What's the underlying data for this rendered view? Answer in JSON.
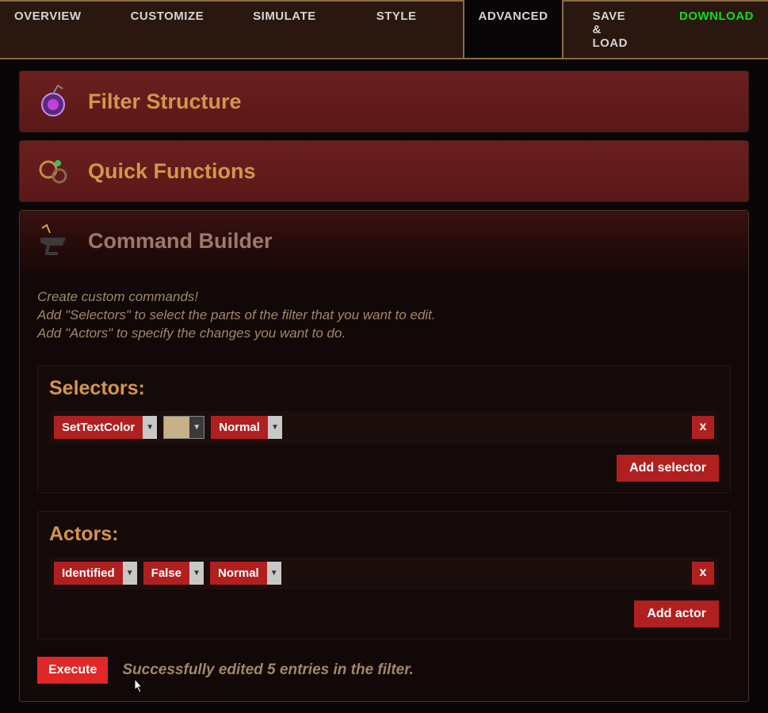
{
  "tabs": {
    "overview": "OVERVIEW",
    "customize": "CUSTOMIZE",
    "simulate": "SIMULATE",
    "style": "STYLE",
    "advanced": "ADVANCED",
    "saveload": "SAVE & LOAD",
    "download": "DOWNLOAD"
  },
  "panels": {
    "filter_structure": "Filter Structure",
    "quick_functions": "Quick Functions",
    "command_builder": "Command Builder"
  },
  "intro": {
    "line1": "Create custom commands!",
    "line2": "Add \"Selectors\" to select the parts of the filter that you want to edit.",
    "line3": "Add \"Actors\" to specify the changes you want to do."
  },
  "selectors": {
    "title": "Selectors:",
    "item1": "SetTextColor",
    "color": "#c8b088",
    "item2": "Normal",
    "close": "x",
    "add": "Add selector"
  },
  "actors": {
    "title": "Actors:",
    "item1": "Identified",
    "item2": "False",
    "item3": "Normal",
    "close": "x",
    "add": "Add actor"
  },
  "execute": {
    "button": "Execute",
    "status": "Successfully edited 5 entries in the filter."
  }
}
